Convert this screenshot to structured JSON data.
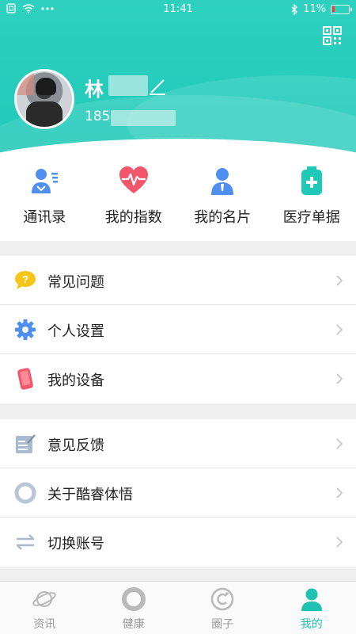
{
  "status_bar": {
    "time": "11:41",
    "battery_text": "11%",
    "icons": [
      "sim-icon",
      "wifi-icon",
      "more-dots-icon",
      "bluetooth-icon",
      "battery-icon"
    ]
  },
  "profile": {
    "name": "林",
    "phone": "185"
  },
  "quick_actions": [
    {
      "label": "通讯录",
      "icon": "contacts-icon"
    },
    {
      "label": "我的指数",
      "icon": "heart-rate-icon"
    },
    {
      "label": "我的名片",
      "icon": "business-card-icon"
    },
    {
      "label": "医疗单据",
      "icon": "medical-records-icon"
    }
  ],
  "menu_group_1": [
    {
      "label": "常见问题",
      "icon": "faq-icon"
    },
    {
      "label": "个人设置",
      "icon": "gear-icon"
    },
    {
      "label": "我的设备",
      "icon": "device-icon"
    }
  ],
  "menu_group_2": [
    {
      "label": "意见反馈",
      "icon": "feedback-icon"
    },
    {
      "label": "关于酷睿体悟",
      "icon": "about-icon"
    },
    {
      "label": "切换账号",
      "icon": "switch-account-icon"
    }
  ],
  "tabs": [
    {
      "label": "资讯",
      "icon": "planet-icon",
      "active": false
    },
    {
      "label": "健康",
      "icon": "health-ring-icon",
      "active": false
    },
    {
      "label": "圈子",
      "icon": "circle-icon",
      "active": false
    },
    {
      "label": "我的",
      "icon": "person-icon",
      "active": true
    }
  ],
  "colors": {
    "accent": "#1fc9b8",
    "active_tab": "#1fc1b0",
    "inactive_tab": "#9a9a9a"
  }
}
